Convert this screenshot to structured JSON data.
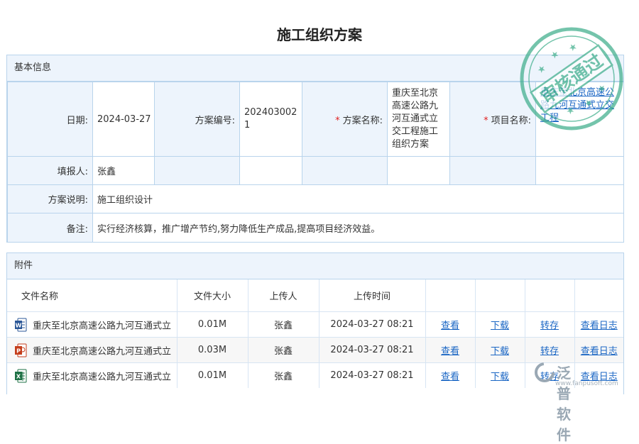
{
  "page": {
    "title": "施工组织方案"
  },
  "basic": {
    "header": "基本信息",
    "date_label": "日期:",
    "date_value": "2024-03-27",
    "plan_no_label": "方案编号:",
    "plan_no_value": "2024030021",
    "plan_name_label": "方案名称:",
    "plan_name_value": "重庆至北京高速公路九河互通式立交工程施工组织方案",
    "project_label": "项目名称:",
    "project_value": "重庆至北京高速公路九河互通式立交工程",
    "filler_label": "填报人:",
    "filler_value": "张鑫",
    "desc_label": "方案说明:",
    "desc_value": "施工组织设计",
    "remark_label": "备注:",
    "remark_value": "实行经济核算，推广增产节约,努力降低生产成品,提高项目经济效益。"
  },
  "attach": {
    "header": "附件",
    "columns": [
      "文件名称",
      "文件大小",
      "上传人",
      "上传时间"
    ],
    "rows": [
      {
        "icon": "word-file-icon",
        "name": "重庆至北京高速公路九河互通式立",
        "size": "0.01M",
        "uploader": "张鑫",
        "time": "2024-03-27 08:21",
        "view": "查看",
        "download": "下载",
        "save": "转存",
        "log": "查看日志"
      },
      {
        "icon": "powerpoint-file-icon",
        "name": "重庆至北京高速公路九河互通式立",
        "size": "0.03M",
        "uploader": "张鑫",
        "time": "2024-03-27 08:21",
        "view": "查看",
        "download": "下载",
        "save": "转存",
        "log": "查看日志"
      },
      {
        "icon": "excel-file-icon",
        "name": "重庆至北京高速公路九河互通式立",
        "size": "0.01M",
        "uploader": "张鑫",
        "time": "2024-03-27 08:21",
        "view": "查看",
        "download": "下载",
        "save": "转存",
        "log": "查看日志"
      }
    ]
  },
  "stamp": {
    "text": "审核通过",
    "color": "#3fae8c"
  },
  "watermark": {
    "brand": "泛普软件",
    "url": "www.fanpusoft.com"
  },
  "colors": {
    "border": "#b9d4ec",
    "header_bg": "#edf4fc",
    "link": "#1a66c4",
    "required": "#e02020"
  }
}
